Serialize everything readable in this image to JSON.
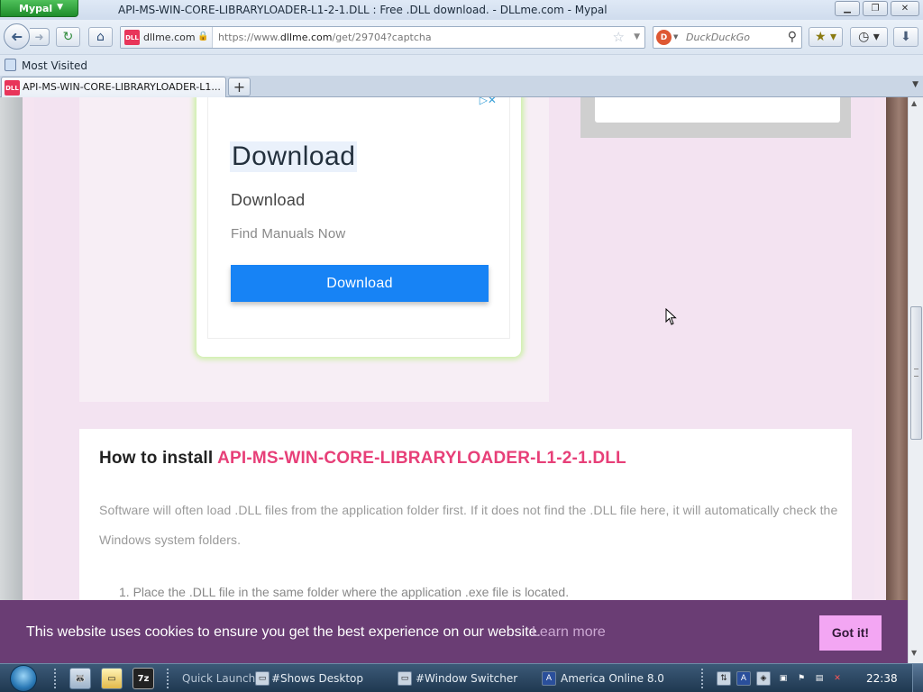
{
  "window": {
    "app_button": "Mypal",
    "title": "API-MS-WIN-CORE-LIBRARYLOADER-L1-2-1.DLL : Free .DLL download. - DLLme.com - Mypal"
  },
  "nav": {
    "site_identity": "dllme.com",
    "url_prefix": "https://www.",
    "url_domain": "dllme.com",
    "url_path": "/get/29704?captcha",
    "search_placeholder": "DuckDuckGo"
  },
  "bookmarks": {
    "most_visited": "Most Visited"
  },
  "tabs": [
    {
      "label": "API-MS-WIN-CORE-LIBRARYLOADER-L1...",
      "favicon": "DLL"
    }
  ],
  "ad": {
    "title": "Download",
    "subtitle": "Download",
    "tagline": "Find Manuals Now",
    "button": "Download"
  },
  "install": {
    "heading_prefix": "How to install",
    "heading_dll": "API-MS-WIN-CORE-LIBRARYLOADER-L1-2-1.DLL",
    "paragraph": "Software will often load .DLL files from the application folder first. If it does not find the .DLL file here, it will automatically check the Windows system folders.",
    "step1": "1.  Place the .DLL file in the same folder where the application .exe file is located."
  },
  "cookie": {
    "message": "This website uses cookies to ensure you get the best experience on our website.",
    "learn_more": "Learn more",
    "accept": "Got it!"
  },
  "taskbar": {
    "quick_launch": "Quick Launch",
    "shows_desktop": "#Shows Desktop",
    "window_switcher": "#Window Switcher",
    "aol": "America Online 8.0",
    "sevenzip": "7z",
    "clock": "22:38"
  },
  "colors": {
    "accent_pink": "#e73f78",
    "ad_button": "#1783f5",
    "cookie_bg": "#6a3d74",
    "cookie_button": "#f3a6f3"
  }
}
